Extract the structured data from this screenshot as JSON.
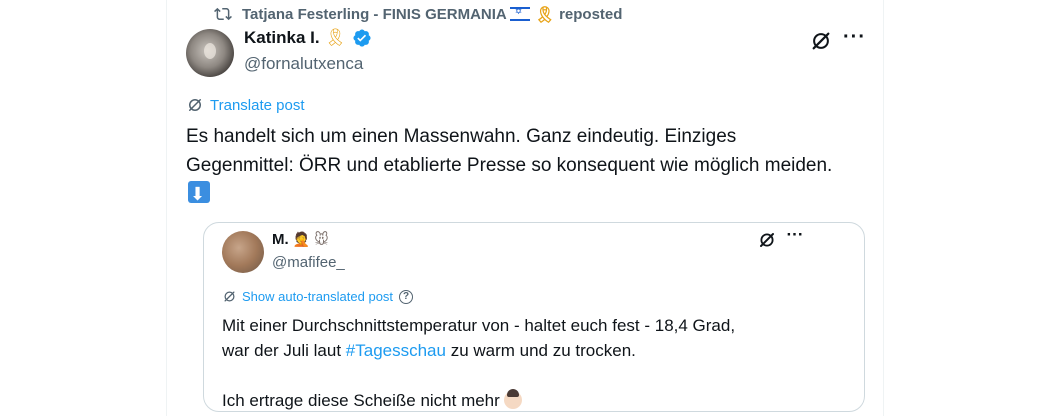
{
  "repost": {
    "reposter_name": "Tatjana Festerling - FINIS GERMANIA",
    "action": "reposted"
  },
  "post": {
    "author_name": "Katinka I.",
    "handle": "@fornalutxenca",
    "translate_label": "Translate post",
    "text": "Es handelt sich um einen Massenwahn. Ganz eindeutig. Einziges Gegenmittel: ÖRR und etablierte Presse so konsequent wie möglich meiden."
  },
  "quote": {
    "author_name": "M.",
    "handle": "@mafifee_",
    "translate_label": "Show auto-translated post",
    "help_symbol": "?",
    "line1": "Mit einer Durchschnittstemperatur von - haltet euch fest - 18,4 Grad,",
    "line2_before": "war der Juli laut ",
    "hashtag": "#Tagesschau",
    "line2_after": " zu warm und zu trocken.",
    "line3": "Ich ertrage diese Scheiße nicht mehr"
  },
  "icons": {
    "repost": "retweet-icon",
    "verified": "verified-badge-icon",
    "grok": "grok-icon",
    "more": "more-icon",
    "translate": "translate-icon"
  },
  "colors": {
    "accent": "#1d9bf0",
    "secondary_text": "#536471",
    "border": "#cfd9de"
  }
}
